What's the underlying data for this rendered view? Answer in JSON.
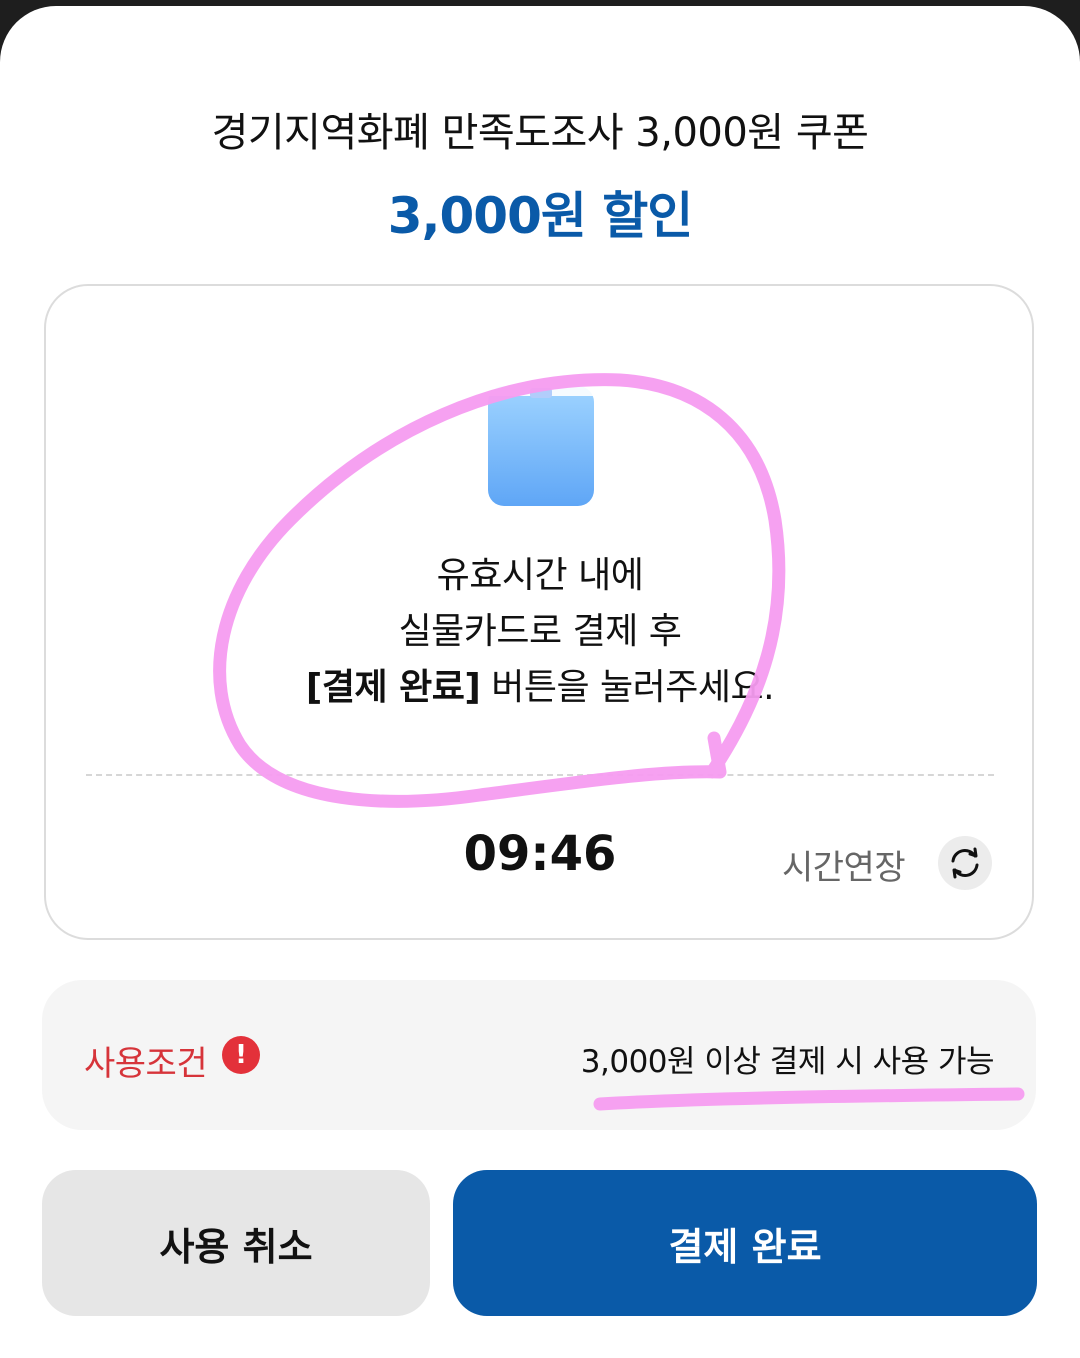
{
  "coupon": {
    "title": "경기지역화폐 만족도조사 3,000원 쿠폰",
    "discount": "3,000원 할인"
  },
  "instructions": {
    "line1": "유효시간 내에",
    "line2": "실물카드로 결제 후",
    "line3_bold": "[결제 완료]",
    "line3_rest": " 버튼을 눌러주세요."
  },
  "timer": {
    "value": "09:46",
    "extend_label": "시간연장",
    "extend_icon": "refresh-icon"
  },
  "conditions": {
    "label": "사용조건",
    "alert_icon": "!",
    "text": "3,000원 이상 결제 시 사용 가능"
  },
  "buttons": {
    "cancel": "사용 취소",
    "complete": "결제 완료"
  },
  "colors": {
    "accent": "#0a5aa8",
    "condition_red": "#d6343a",
    "annotation_pink": "#f59cf0"
  }
}
